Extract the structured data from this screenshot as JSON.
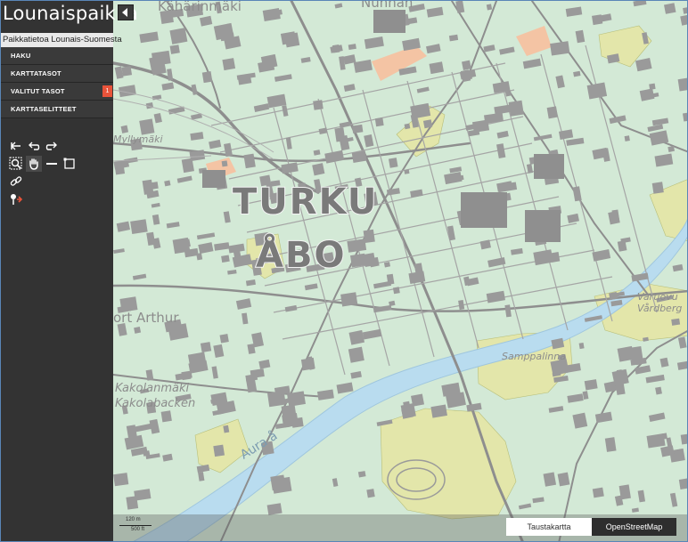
{
  "app": {
    "logo_text": "Lounaispaikka",
    "tagline": "Paikkatietoa Lounais-Suomesta"
  },
  "menu": {
    "items": [
      {
        "label": "HAKU",
        "badge": ""
      },
      {
        "label": "KARTTATASOT",
        "badge": ""
      },
      {
        "label": "VALITUT TASOT",
        "badge": "1"
      },
      {
        "label": "KARTTASELITTEET",
        "badge": ""
      }
    ]
  },
  "toolbar": {
    "tools": [
      {
        "icon": "history-back-icon"
      },
      {
        "icon": "undo-icon"
      },
      {
        "icon": "redo-icon"
      },
      {
        "icon": "zoom-box-icon"
      },
      {
        "icon": "pan-hand-icon"
      },
      {
        "icon": "measure-line-icon"
      },
      {
        "icon": "measure-area-icon"
      },
      {
        "icon": "link-icon"
      },
      {
        "icon": "marker-icon"
      }
    ]
  },
  "map": {
    "city_name_fi": "TURKU",
    "city_name_sv": "ÅBO",
    "place_labels": {
      "kaharinmaki": "Kähärinmäki",
      "nunnan": "Nunnan",
      "myllymaki": "Myllymäki",
      "port_arthur": "ort Arthur",
      "kakolanmaki": "Kakolanmäki",
      "kakolabacken": "Kakolabacken",
      "aura": "Aura å",
      "vartiovuori": "Vartiovu",
      "vardberget": "Vårdberg",
      "samppalinna": "Samppalinna"
    },
    "colors": {
      "background": "#d3e9d6",
      "building": "#9a9a9a",
      "road": "#8e8e8e",
      "river": "#b9dcef",
      "park": "#e3e6aa",
      "highlight": "#f4c4a4"
    }
  },
  "scale": {
    "top_label": "120 m",
    "bottom_label": "500 ft"
  },
  "background_switcher": {
    "option_a": "Taustakartta",
    "option_b": "OpenStreetMap",
    "selected": "OpenStreetMap"
  }
}
